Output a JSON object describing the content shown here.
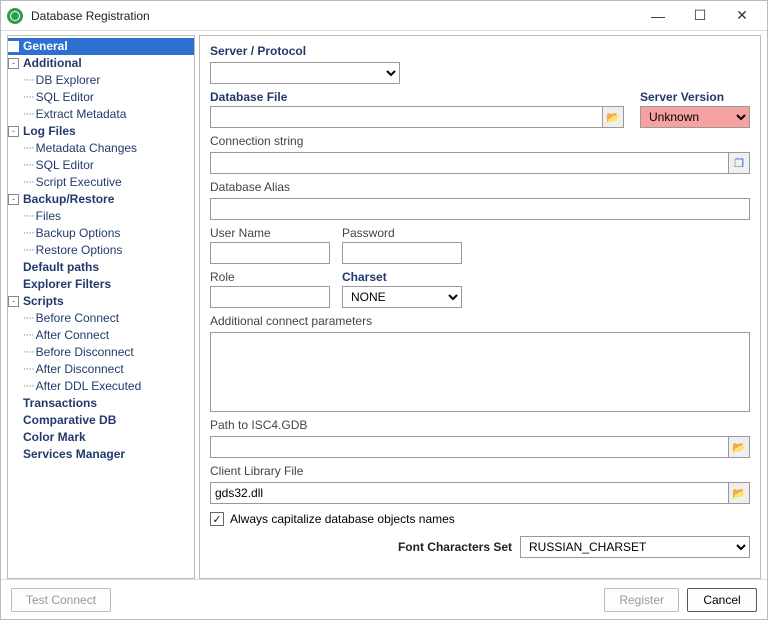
{
  "window": {
    "title": "Database Registration"
  },
  "tree": {
    "items": [
      {
        "label": "General",
        "bold": true,
        "selected": true,
        "toggle": null
      },
      {
        "label": "Additional",
        "bold": true,
        "toggle": "-",
        "children": [
          {
            "label": "DB Explorer"
          },
          {
            "label": "SQL Editor"
          },
          {
            "label": "Extract Metadata"
          }
        ]
      },
      {
        "label": "Log Files",
        "bold": true,
        "toggle": "-",
        "children": [
          {
            "label": "Metadata Changes"
          },
          {
            "label": "SQL Editor"
          },
          {
            "label": "Script Executive"
          }
        ]
      },
      {
        "label": "Backup/Restore",
        "bold": true,
        "toggle": "-",
        "children": [
          {
            "label": "Files"
          },
          {
            "label": "Backup Options"
          },
          {
            "label": "Restore Options"
          }
        ]
      },
      {
        "label": "Default paths",
        "bold": true,
        "toggle": null
      },
      {
        "label": "Explorer Filters",
        "bold": true,
        "toggle": null
      },
      {
        "label": "Scripts",
        "bold": true,
        "toggle": "-",
        "children": [
          {
            "label": "Before Connect"
          },
          {
            "label": "After Connect"
          },
          {
            "label": "Before Disconnect"
          },
          {
            "label": "After Disconnect"
          },
          {
            "label": "After DDL Executed"
          }
        ]
      },
      {
        "label": "Transactions",
        "bold": true,
        "toggle": null
      },
      {
        "label": "Comparative DB",
        "bold": true,
        "toggle": null
      },
      {
        "label": "Color Mark",
        "bold": true,
        "toggle": null
      },
      {
        "label": "Services Manager",
        "bold": true,
        "toggle": null
      }
    ]
  },
  "form": {
    "server_protocol_label": "Server / Protocol",
    "server_protocol_value": "",
    "database_file_label": "Database File",
    "database_file_value": "",
    "server_version_label": "Server Version",
    "server_version_value": "Unknown",
    "connection_string_label": "Connection string",
    "connection_string_value": "",
    "database_alias_label": "Database Alias",
    "database_alias_value": "",
    "username_label": "User Name",
    "username_value": "",
    "password_label": "Password",
    "password_value": "",
    "role_label": "Role",
    "role_value": "",
    "charset_label": "Charset",
    "charset_value": "NONE",
    "addl_params_label": "Additional connect parameters",
    "addl_params_value": "",
    "isc4_label": "Path to ISC4.GDB",
    "isc4_value": "",
    "client_lib_label": "Client Library File",
    "client_lib_value": "gds32.dll",
    "always_capitalize_label": "Always capitalize database objects names",
    "always_capitalize_checked": true,
    "font_charset_label": "Font Characters Set",
    "font_charset_value": "RUSSIAN_CHARSET"
  },
  "footer": {
    "test_connect": "Test Connect",
    "register": "Register",
    "cancel": "Cancel"
  }
}
